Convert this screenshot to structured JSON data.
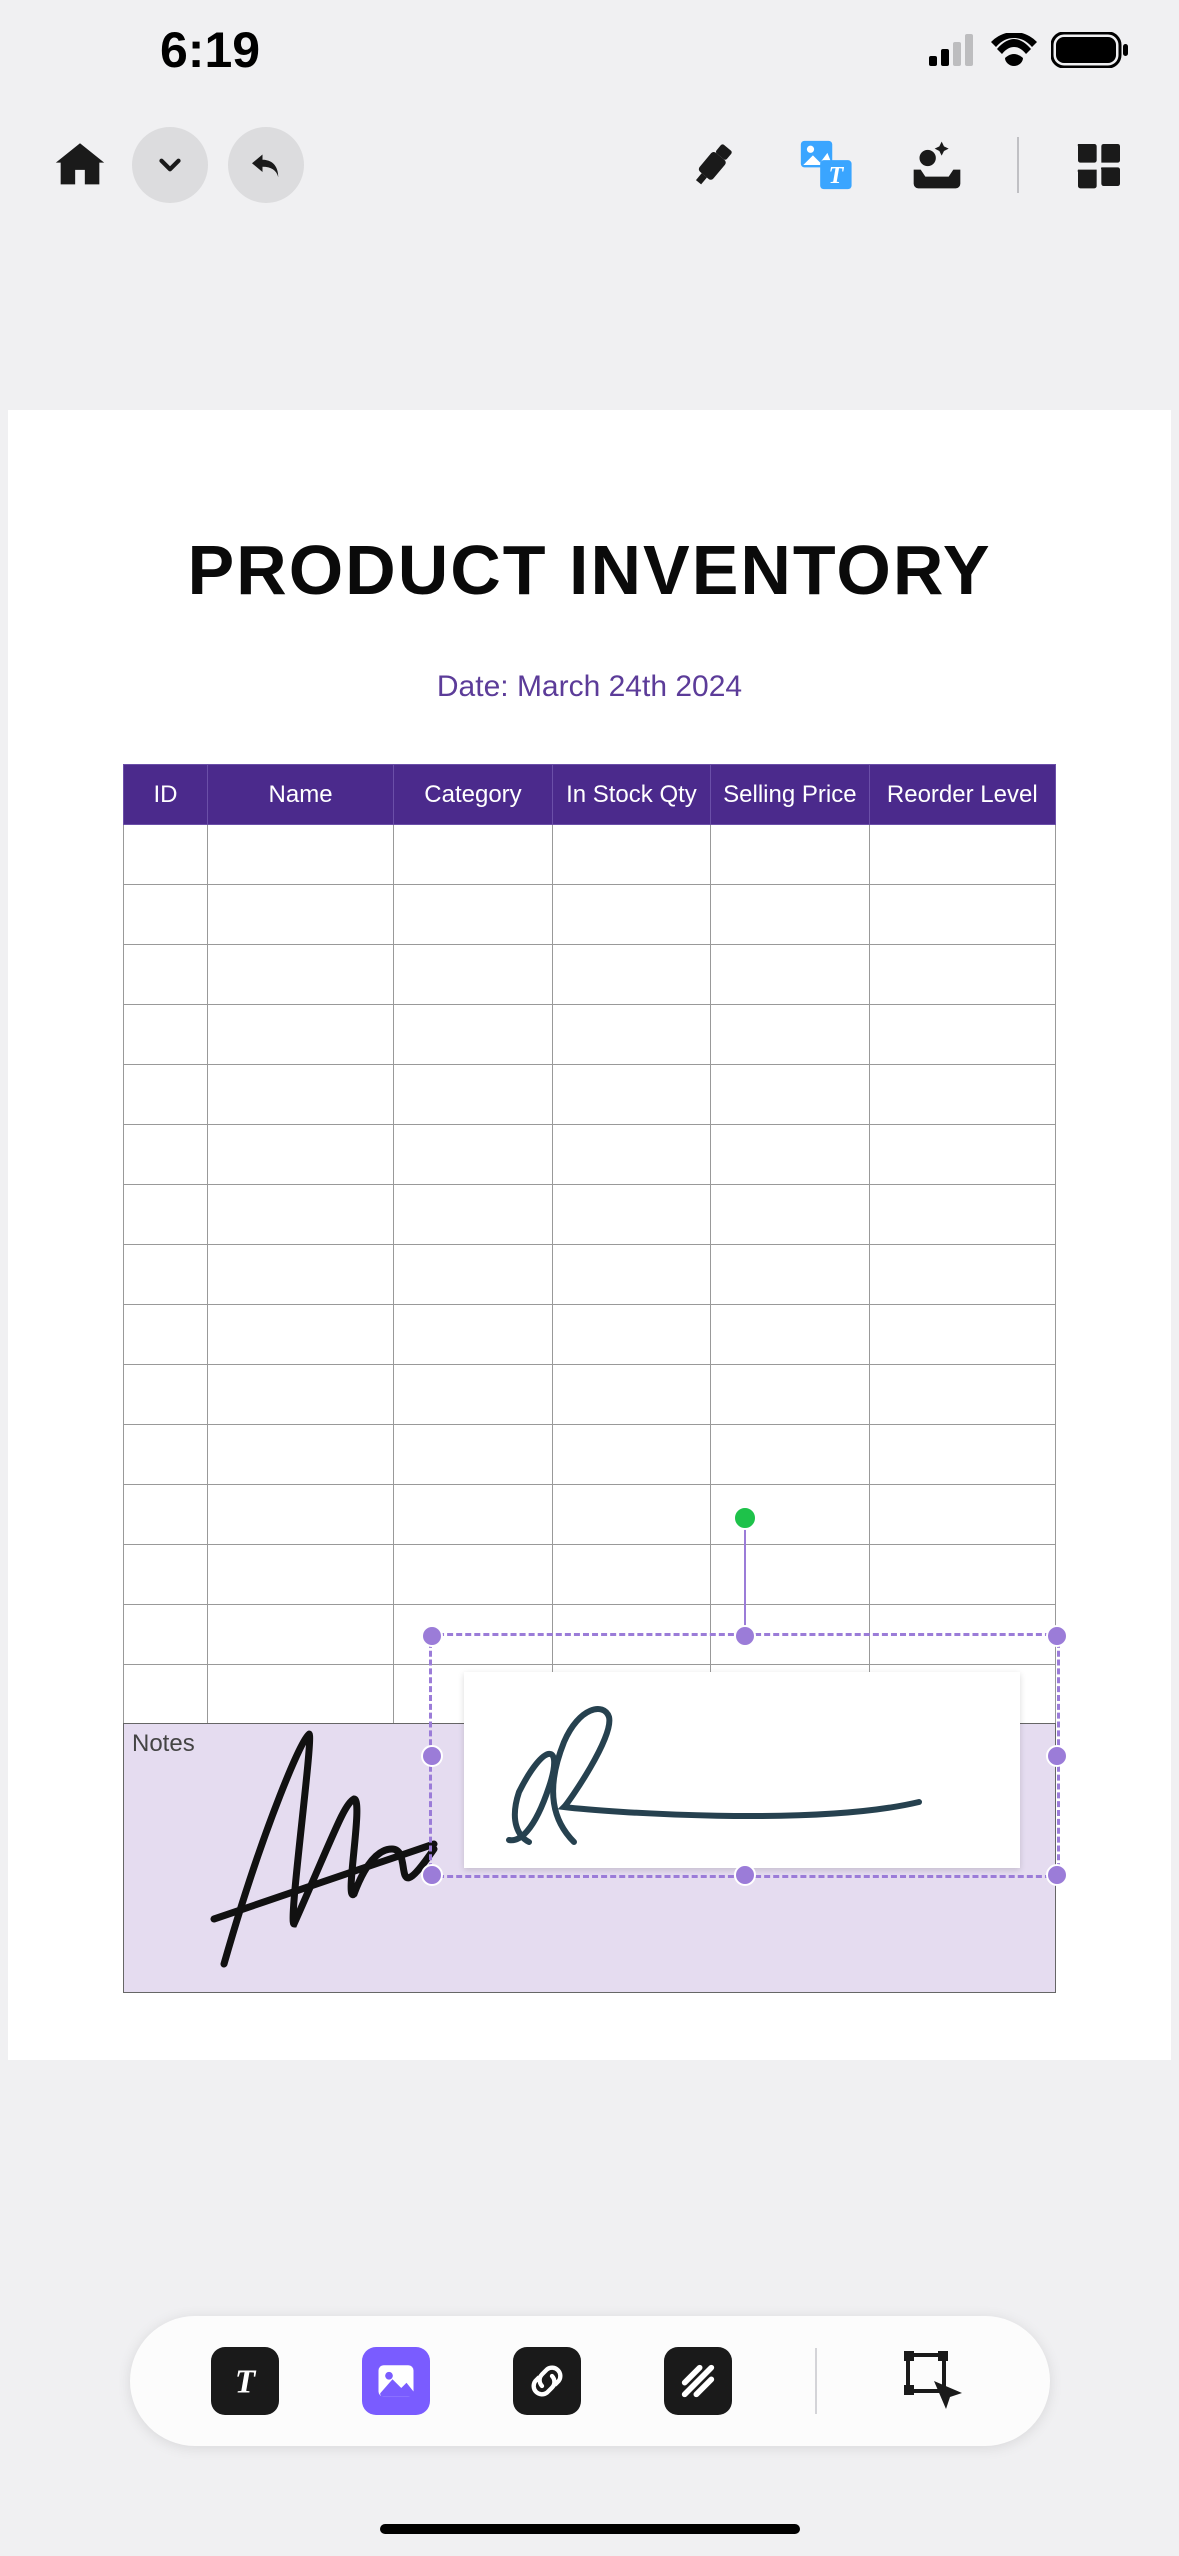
{
  "status": {
    "time": "6:19"
  },
  "document": {
    "title": "PRODUCT INVENTORY",
    "date_prefix": "Date: ",
    "date_value": "March 24th 2024"
  },
  "table": {
    "headers": [
      "ID",
      "Name",
      "Category",
      "In Stock Qty",
      "Selling Price",
      "Reorder Level"
    ],
    "row_count": 15,
    "notes_label": "Notes"
  }
}
